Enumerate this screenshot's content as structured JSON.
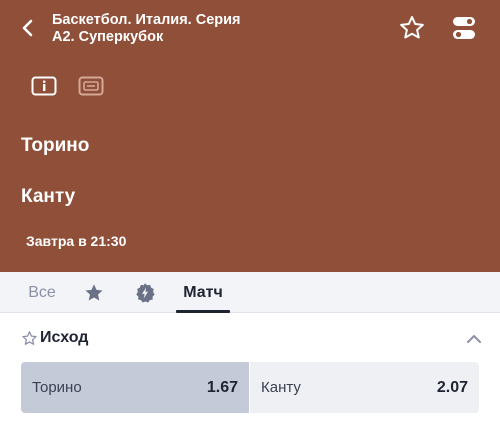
{
  "header": {
    "title_line1": "Баскетбол. Италия. Серия",
    "title_line2": "А2. Суперкубок",
    "back_icon": "chevron-left-icon",
    "favorite_icon": "star-outline-icon",
    "toggle_icon": "toggle-switch-icon"
  },
  "hero": {
    "background": "#8f4f38",
    "team1": "Торино",
    "team2": "Канту",
    "datetime": "Завтра в 21:30"
  },
  "tabs": {
    "all_label": "Все",
    "match_label": "Матч",
    "active": "Матч"
  },
  "market": {
    "title": "Исход",
    "outcomes": [
      {
        "name": "Торино",
        "odds": "1.67"
      },
      {
        "name": "Канту",
        "odds": "2.07"
      }
    ]
  }
}
